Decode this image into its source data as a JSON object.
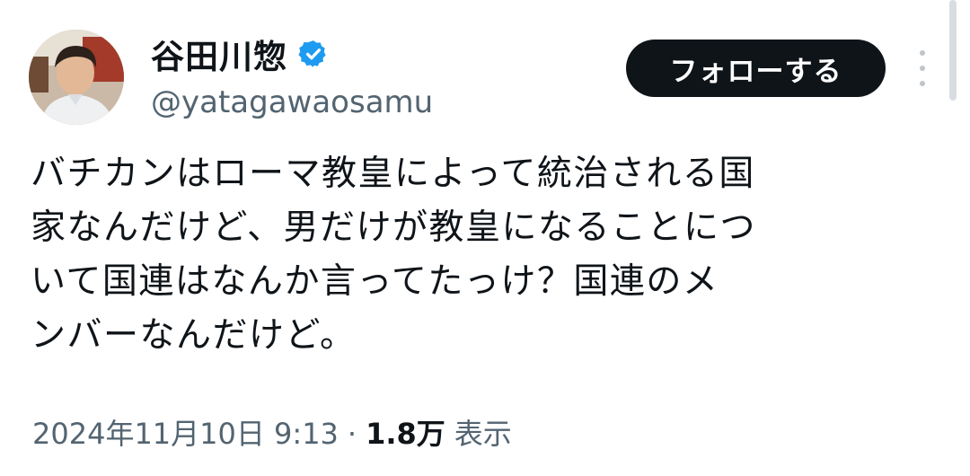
{
  "author": {
    "display_name": "谷田川惣",
    "handle": "@yatagawaosamu",
    "avatar_icon": "profile-photo",
    "verified_icon": "verified-badge-icon",
    "verified_color": "#1d9bf0"
  },
  "actions": {
    "follow_label": "フォローする",
    "more_icon": "more-vertical-icon"
  },
  "tweet": {
    "text": "バチカンはローマ教皇によって統治される国\n家なんだけど、男だけが教皇になることにつ\nいて国連はなんか言ってたっけ？国連のメ\nンバーなんだけど。",
    "timestamp": "2024年11月10日 9:13",
    "separator": "·",
    "views_count": "1.8万",
    "views_label": "表示"
  },
  "colors": {
    "text_primary": "#0f1419",
    "text_secondary": "#536471",
    "button_bg": "#0f1419"
  }
}
